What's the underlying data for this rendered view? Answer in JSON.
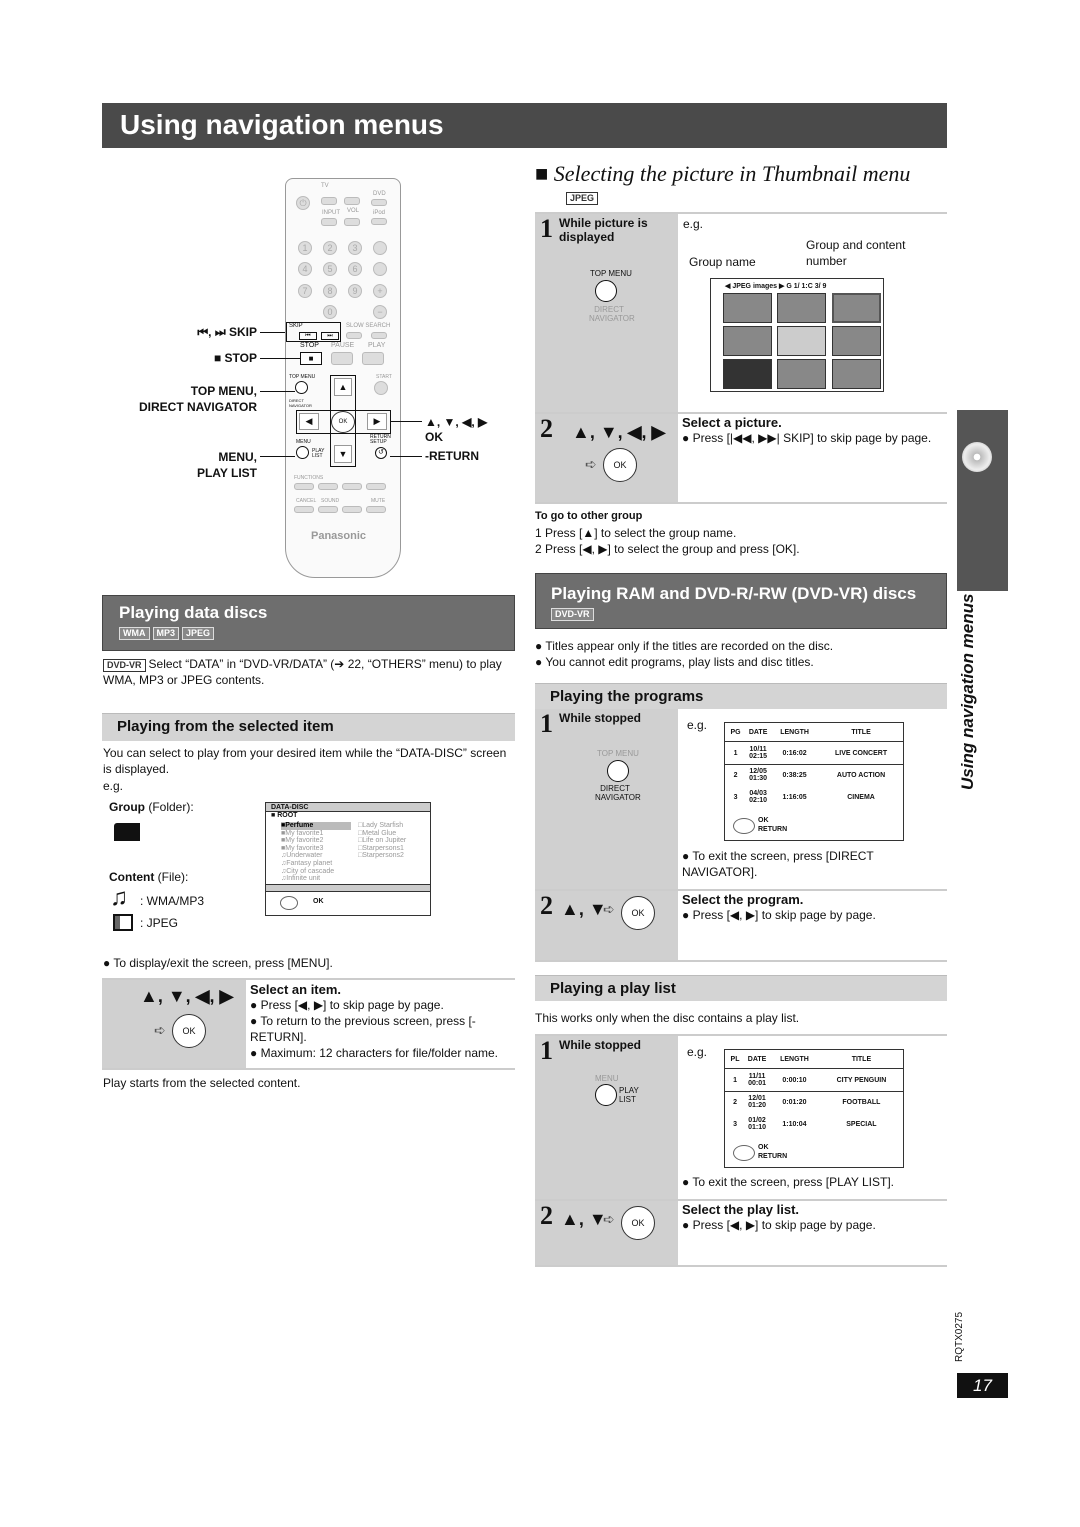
{
  "page_title": "Using navigation menus",
  "remote": {
    "labels": {
      "skip": "SKIP",
      "stop": "STOP",
      "top_menu": "TOP MENU,",
      "direct_navigator": "DIRECT NAVIGATOR",
      "menu": "MENU,",
      "play_list": "PLAY LIST",
      "arrows": "▲, ▼, ◀, ▶",
      "ok": "OK",
      "return": "-RETURN"
    },
    "printed": {
      "tv": "TV",
      "dvd": "DVD",
      "ipod": "iPod",
      "input": "INPUT",
      "vol": "VOL",
      "stop": "STOP",
      "pause": "PAUSE",
      "play": "PLAY",
      "top_menu": "TOP MENU",
      "start": "START",
      "direct": "DIRECT NAVIGATOR",
      "menu": "MENU",
      "play_list": "PLAY LIST",
      "return": "RETURN SETUP",
      "ok": "OK",
      "slow_search": "SLOW SEARCH",
      "skip": "SKIP",
      "brand": "Panasonic",
      "bottom_row": [
        "FUNCTIONS",
        "SOUND",
        "CANCEL",
        "MUTE"
      ],
      "numbers": [
        "1",
        "2",
        "3",
        "4",
        "5",
        "6",
        "7",
        "8",
        "9",
        "0"
      ]
    }
  },
  "data_discs": {
    "title": "Playing data discs",
    "badges": [
      "WMA",
      "MP3",
      "JPEG"
    ],
    "note_badge": "DVD-VR",
    "note": "Select “DATA” in “DVD-VR/DATA” (➔ 22, “OTHERS” menu) to play WMA, MP3 or JPEG contents."
  },
  "selected_item": {
    "title": "Playing from the selected item",
    "intro": "You can select to play from your desired item while the “DATA-DISC” screen is displayed.",
    "eg": "e.g.",
    "group_label": "Group",
    "group_paren": "(Folder):",
    "content_label": "Content",
    "content_paren": "(File):",
    "wma": ": WMA/MP3",
    "jpeg": ": JPEG",
    "screen": {
      "title": "DATA-DISC",
      "root": "ROOT",
      "folders": [
        "Perfume",
        "My favorite1",
        "My favorite2",
        "My favorite3"
      ],
      "tracks": [
        "Underwater",
        "Fantasy planet",
        "City of cascade",
        "Infinite unit"
      ],
      "right": [
        "Lady Starfish",
        "Metal Glue",
        "Life on Jupiter",
        "Starpersons1",
        "Starpersons2"
      ],
      "ok": "OK"
    },
    "menu_note": "● To display/exit the screen, press [MENU].",
    "step_arrows": "▲, ▼, ◀, ▶",
    "ok": "OK",
    "step_title": "Select an item.",
    "bullets": [
      "● Press [◀, ▶] to skip page by page.",
      "● To return to the previous screen, press [-RETURN].",
      "● Maximum: 12 characters for file/folder name."
    ],
    "footer": "Play starts from the selected content."
  },
  "thumbnail": {
    "title": "Selecting the picture in Thumbnail menu",
    "badge": "JPEG",
    "step1_num": "1",
    "step1": "While picture is displayed",
    "top_menu": "TOP MENU",
    "direct": "DIRECT NAVIGATOR",
    "eg": "e.g.",
    "group_name": "Group name",
    "group_content": "Group and content number",
    "screen_header": "◀ JPEG  images  ▶ G  1/   1:C   3/   9",
    "step2_num": "2",
    "step2_arrows": "▲, ▼, ◀, ▶",
    "ok": "OK",
    "step2_title": "Select a picture.",
    "step2_text": "● Press [|◀◀, ▶▶| SKIP] to skip page by page.",
    "other_title": "To go to other group",
    "other": [
      "1  Press [▲] to select the group name.",
      "2  Press [◀, ▶] to select the group and press [OK]."
    ]
  },
  "ram": {
    "title": "Playing RAM and DVD-R/-RW (DVD-VR) discs",
    "badge": "DVD-VR",
    "bullets": [
      "● Titles appear only if the titles are recorded on the disc.",
      "● You cannot edit programs, play lists and disc titles."
    ]
  },
  "programs": {
    "title": "Playing the programs",
    "step1_num": "1",
    "step1": "While stopped",
    "top_menu": "TOP MENU",
    "direct": "DIRECT NAVIGATOR",
    "eg": "e.g.",
    "headers": [
      "PG",
      "DATE",
      "LENGTH",
      "TITLE"
    ],
    "rows": [
      [
        "1",
        "10/11 02:15",
        "0:16:02",
        "LIVE CONCERT"
      ],
      [
        "2",
        "12/05 01:30",
        "0:38:25",
        "AUTO ACTION"
      ],
      [
        "3",
        "04/03 02:10",
        "1:16:05",
        "CINEMA"
      ]
    ],
    "ok": "OK",
    "return": "RETURN",
    "exit": "● To exit the screen, press [DIRECT NAVIGATOR].",
    "step2_num": "2",
    "step2_arrows": "▲, ▼",
    "ok_btn": "OK",
    "step2_title": "Select the program.",
    "step2_text": "● Press [◀, ▶] to skip page by page."
  },
  "playlist": {
    "title": "Playing a play list",
    "intro": "This works only when the disc contains a play list.",
    "step1_num": "1",
    "step1": "While stopped",
    "menu": "MENU",
    "play_list": "PLAY LIST",
    "eg": "e.g.",
    "headers": [
      "PL",
      "DATE",
      "LENGTH",
      "TITLE"
    ],
    "rows": [
      [
        "1",
        "11/11 00:01",
        "0:00:10",
        "CITY PENGUIN"
      ],
      [
        "2",
        "12/01 01:20",
        "0:01:20",
        "FOOTBALL"
      ],
      [
        "3",
        "01/02 01:10",
        "1:10:04",
        "SPECIAL"
      ]
    ],
    "ok": "OK",
    "return": "RETURN",
    "exit": "● To exit the screen, press [PLAY LIST].",
    "step2_num": "2",
    "step2_arrows": "▲, ▼",
    "ok_btn": "OK",
    "step2_title": "Select the play list.",
    "step2_text": "● Press [◀, ▶] to skip page by page."
  },
  "side_tab": "Using navigation menus",
  "doc_code": "RQTX0275",
  "page_number": "17"
}
